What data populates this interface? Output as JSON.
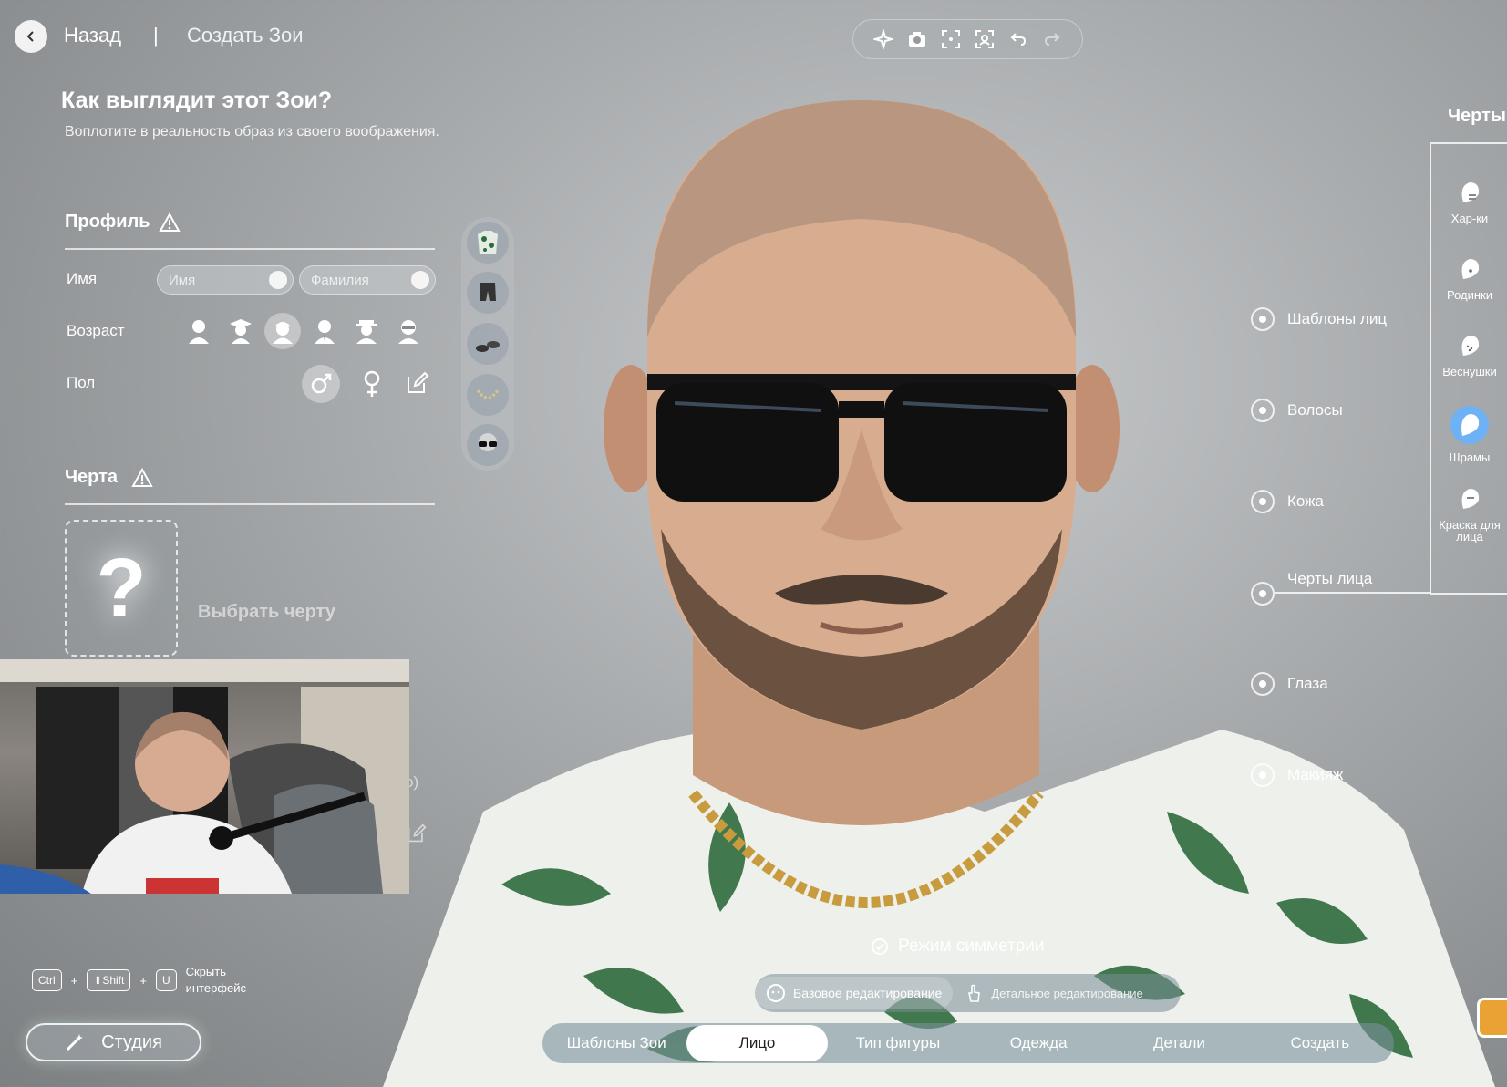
{
  "header": {
    "back_label": "Назад",
    "separator": "|",
    "current": "Создать Зои"
  },
  "toolbar": {
    "icons": [
      "sparkle-icon",
      "camera-icon",
      "focus-icon",
      "face-scan-icon",
      "undo-icon",
      "redo-icon"
    ]
  },
  "page": {
    "title": "Как выглядит этот Зои?",
    "subtitle": "Воплотите в реальность образ из своего воображения."
  },
  "profile": {
    "title": "Профиль",
    "name_label": "Имя",
    "first_name_placeholder": "Имя",
    "last_name_placeholder": "Фамилия",
    "age_label": "Возраст",
    "gender_label": "Пол"
  },
  "trait_section": {
    "title": "Черта",
    "pick_label": "Выбрать черту",
    "question_mark": "?"
  },
  "partial": {
    "left_clip": "o)"
  },
  "markers": [
    {
      "label": "Шаблоны лиц"
    },
    {
      "label": "Волосы"
    },
    {
      "label": "Кожа"
    },
    {
      "label": "Черты лица"
    },
    {
      "label": "Глаза"
    },
    {
      "label": "Макияж"
    }
  ],
  "traits_panel": {
    "title": "Черты",
    "tabs": [
      {
        "label": "Хар-ки"
      },
      {
        "label": "Родинки"
      },
      {
        "label": "Веснушки"
      },
      {
        "label": "Шрамы"
      },
      {
        "label": "Краска для лица"
      }
    ]
  },
  "hotkeys": {
    "ctrl": "Ctrl",
    "plus": "+",
    "shift": "⬆Shift",
    "u": "U",
    "hide_text_line1": "Скрыть",
    "hide_text_line2": "интерфейс"
  },
  "studio_label": "Студия",
  "symmetry_label": "Режим симметрии",
  "edit_modes": {
    "basic": "Базовое редактирование",
    "detailed": "Детальное редактирование"
  },
  "tabs": [
    "Шаблоны Зои",
    "Лицо",
    "Тип фигуры",
    "Одежда",
    "Детали",
    "Создать"
  ],
  "colors": {
    "accent_active": "#6fb1f5",
    "background": "#a9acae"
  }
}
